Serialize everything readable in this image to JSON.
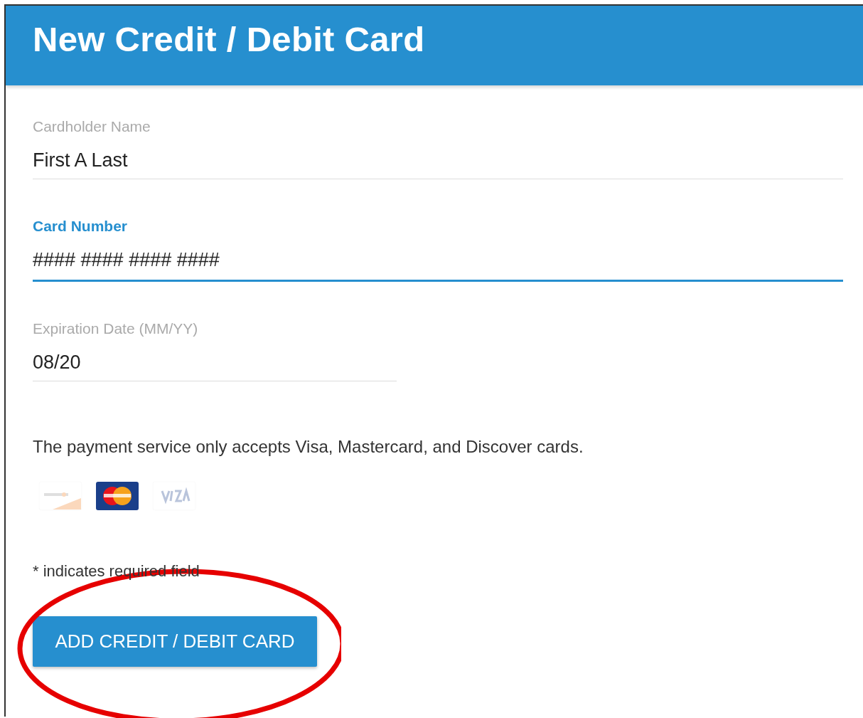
{
  "header": {
    "title": "New Credit / Debit Card"
  },
  "fields": [
    {
      "label": "Cardholder Name",
      "value": "First A Last",
      "focused": false,
      "kind": "text"
    },
    {
      "label": "Card Number",
      "value": "#### #### #### ####",
      "focused": true,
      "kind": "text"
    },
    {
      "label": "Expiration Date (MM/YY)",
      "value": "08/20",
      "focused": false,
      "kind": "date"
    }
  ],
  "notice": "The payment service only accepts Visa, Mastercard, and Discover cards.",
  "card_logos": [
    {
      "kind": "discover",
      "disabled": true
    },
    {
      "kind": "mastercard",
      "disabled": false
    },
    {
      "kind": "visa",
      "disabled": true
    }
  ],
  "footnote": "* indicates required field",
  "submit_button": {
    "label": "ADD CREDIT / DEBIT CARD"
  },
  "annotation": {
    "kind": "ellipse",
    "color": "#e60000"
  }
}
